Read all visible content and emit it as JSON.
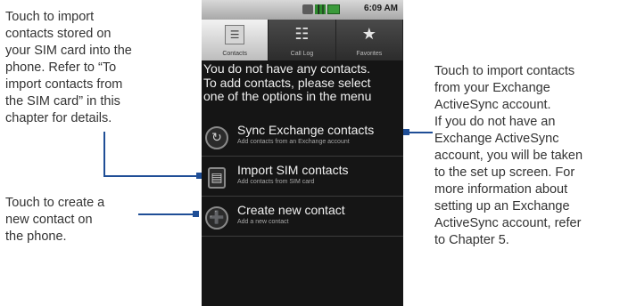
{
  "callouts": {
    "sim_import": [
      "Touch to import",
      "contacts stored on",
      "your SIM card into the",
      "phone. Refer to “To",
      "import contacts from",
      "the SIM card” in this",
      "chapter for details."
    ],
    "create_contact": [
      "Touch to create a",
      "new contact on",
      "the phone."
    ],
    "exchange": [
      "Touch to import contacts",
      "from your Exchange",
      "ActiveSync account.",
      "If you do not have an",
      "Exchange ActiveSync",
      "account, you will be taken",
      "to the set up screen. For",
      "more information about",
      "setting up an Exchange",
      "ActiveSync account, refer",
      "to Chapter 5."
    ]
  },
  "phone": {
    "status_bar": {
      "time": "6:09 AM",
      "icons": [
        "sync-icon",
        "signal-icon",
        "battery-icon"
      ]
    },
    "tabs": [
      {
        "label": "Contacts",
        "icon": "contacts-tab-icon",
        "glyph": "☰",
        "active": true
      },
      {
        "label": "Call Log",
        "icon": "call-log-tab-icon",
        "glyph": "☷",
        "active": false
      },
      {
        "label": "Favorites",
        "icon": "star-icon",
        "glyph": "★",
        "active": false
      }
    ],
    "empty_message": [
      "You do not have any contacts.",
      "To add contacts, please select",
      "one of the options in the menu"
    ],
    "options": [
      {
        "title": "Sync Exchange contacts",
        "subtitle": "Add contacts from an Exchange account",
        "icon": "sync-icon",
        "glyph": "↻"
      },
      {
        "title": "Import SIM contacts",
        "subtitle": "Add contacts from SIM card",
        "icon": "sim-card-icon",
        "glyph": "▤"
      },
      {
        "title": "Create new contact",
        "subtitle": "Add a new contact",
        "icon": "add-contact-icon",
        "glyph": "➕"
      }
    ]
  },
  "colors": {
    "leader_line": "#1f4e96",
    "callout_text": "#333333",
    "phone_background": "#151515"
  }
}
